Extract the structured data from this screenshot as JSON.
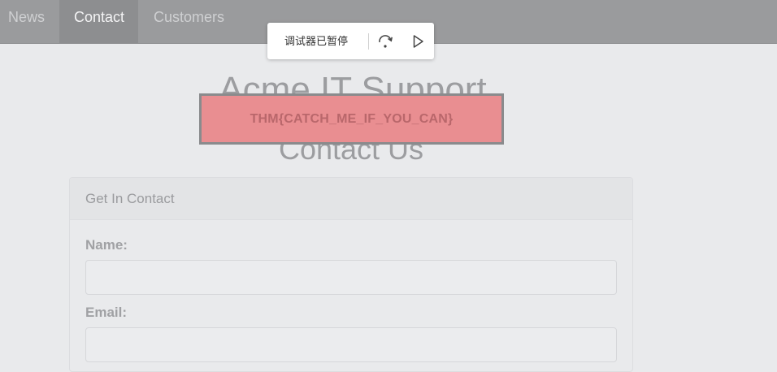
{
  "nav": {
    "items": [
      {
        "label": "News",
        "active": false
      },
      {
        "label": "Contact",
        "active": true
      },
      {
        "label": "Customers",
        "active": false
      }
    ]
  },
  "debugger": {
    "status_label": "调试器已暂停",
    "step_over_icon": "step-over-icon",
    "resume_icon": "resume-play-icon"
  },
  "page": {
    "title": "Acme IT Support",
    "subtitle": "Contact Us"
  },
  "flag_banner": {
    "text": "THM{CATCH_ME_IF_YOU_CAN}",
    "background_color": "#e98e91"
  },
  "contact_panel": {
    "title": "Get In Contact",
    "fields": {
      "name": {
        "label": "Name:",
        "value": ""
      },
      "email": {
        "label": "Email:",
        "value": ""
      }
    }
  },
  "colors": {
    "nav_background": "#9a9b9d",
    "page_background": "#e9eaec"
  }
}
